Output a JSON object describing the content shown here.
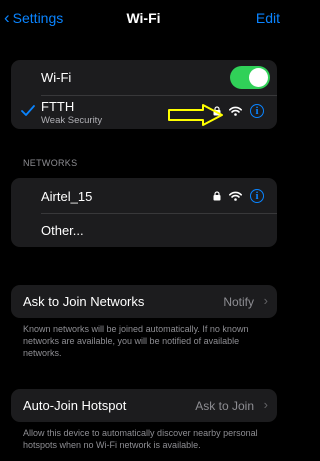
{
  "nav": {
    "back_label": "Settings",
    "title": "Wi-Fi",
    "edit_label": "Edit"
  },
  "wifi_group": {
    "toggle_label": "Wi-Fi",
    "toggle_on": true,
    "current_network": {
      "name": "FTTH",
      "subtitle": "Weak Security",
      "info_glyph": "i"
    }
  },
  "networks": {
    "header": "NETWORKS",
    "items": [
      {
        "name": "Airtel_15",
        "locked": true,
        "info_glyph": "i"
      },
      {
        "name": "Other..."
      }
    ]
  },
  "ask_to_join": {
    "label": "Ask to Join Networks",
    "value": "Notify",
    "footer": "Known networks will be joined automatically. If no known networks are available, you will be notified of available networks."
  },
  "auto_join": {
    "label": "Auto-Join Hotspot",
    "value": "Ask to Join",
    "footer": "Allow this device to automatically discover nearby personal hotspots when no Wi-Fi network is available."
  },
  "colors": {
    "accent": "#0a84ff",
    "toggle_on": "#30d158",
    "annotation_arrow": "#ffff00",
    "cell_bg": "#1c1c1e"
  }
}
